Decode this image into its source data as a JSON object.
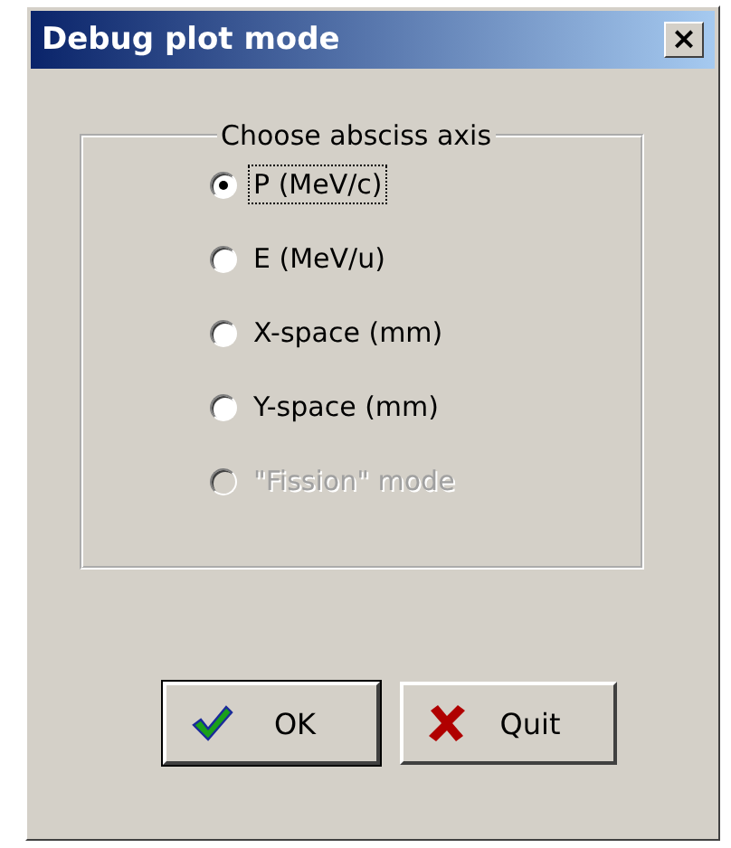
{
  "window": {
    "title": "Debug plot mode",
    "close": "×"
  },
  "group": {
    "title": "Choose absciss axis",
    "options": [
      {
        "label": "P (MeV/c)",
        "selected": true,
        "focused": true,
        "disabled": false
      },
      {
        "label": "E (MeV/u)",
        "selected": false,
        "focused": false,
        "disabled": false
      },
      {
        "label": "X-space (mm)",
        "selected": false,
        "focused": false,
        "disabled": false
      },
      {
        "label": "Y-space (mm)",
        "selected": false,
        "focused": false,
        "disabled": false
      },
      {
        "label": "\"Fission\" mode",
        "selected": false,
        "focused": false,
        "disabled": true
      }
    ]
  },
  "buttons": [
    {
      "label": "OK",
      "kind": "ok",
      "default": true
    },
    {
      "label": "Quit",
      "kind": "quit",
      "default": false
    }
  ]
}
